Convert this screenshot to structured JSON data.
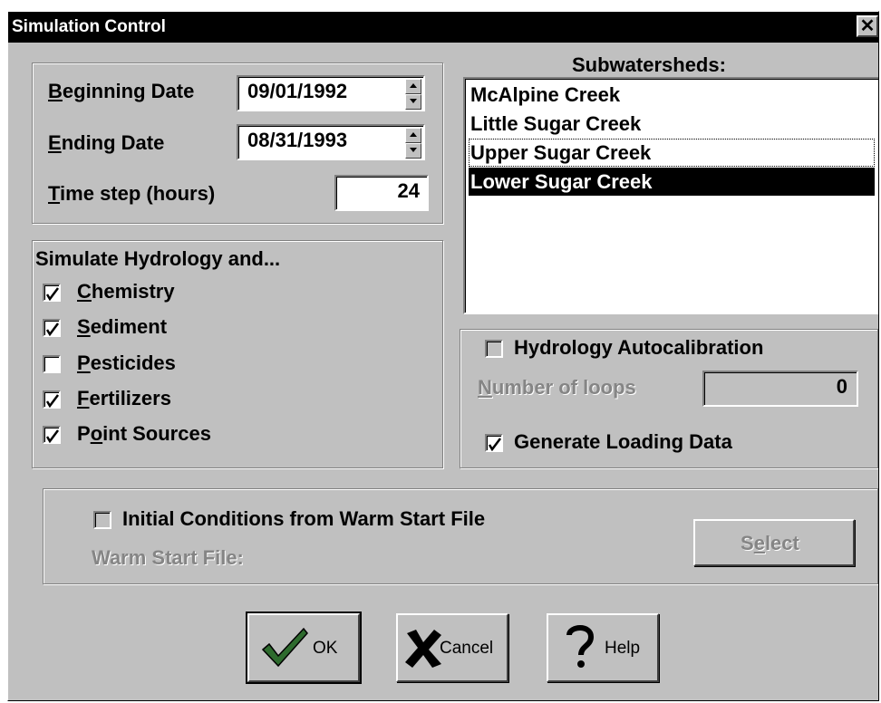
{
  "window": {
    "title": "Simulation Control",
    "close_glyph": "✕"
  },
  "dates": {
    "beginning_label_u": "B",
    "beginning_label_rest": "eginning Date",
    "beginning_value": "09/01/1992",
    "ending_label_u": "E",
    "ending_label_rest": "nding Date",
    "ending_value": "08/31/1993",
    "timestep_label_u": "T",
    "timestep_label_rest": "ime step (hours)",
    "timestep_value": "24"
  },
  "simulate": {
    "title": "Simulate Hydrology and...",
    "items": [
      {
        "u": "C",
        "rest": "hemistry",
        "checked": true
      },
      {
        "u": "S",
        "rest": "ediment",
        "checked": true
      },
      {
        "u": "P",
        "rest": "esticides",
        "checked": false
      },
      {
        "u": "F",
        "rest": "ertilizers",
        "checked": true
      },
      {
        "pre": "P",
        "u": "o",
        "rest": "int Sources",
        "checked": true
      }
    ]
  },
  "subwatersheds": {
    "title": "Subwatersheds:",
    "items": [
      "McAlpine Creek",
      "Little Sugar Creek",
      "Upper Sugar Creek",
      "Lower Sugar Creek"
    ],
    "focused_index": 2,
    "selected_index": 3
  },
  "autocal": {
    "label": "Hydrology Autocalibration",
    "checked": false,
    "loops_label_u": "N",
    "loops_label_rest": "umber of loops",
    "loops_value": "0",
    "generate_label": "Generate Loading Data",
    "generate_checked": true
  },
  "warmstart": {
    "label": "Initial Conditions from Warm Start File",
    "checked": false,
    "file_label": "Warm Start File:",
    "select_pre": "S",
    "select_u": "e",
    "select_rest": "lect"
  },
  "buttons": {
    "ok": "OK",
    "cancel": "Cancel",
    "help": "Help"
  },
  "colors": {
    "face": "#c0c0c0",
    "title_bg": "#000000",
    "disabled_text": "#858585",
    "check_green": "#2e6b2e"
  },
  "icons": {
    "ok": "check-icon",
    "cancel": "x-icon",
    "help": "question-icon"
  }
}
